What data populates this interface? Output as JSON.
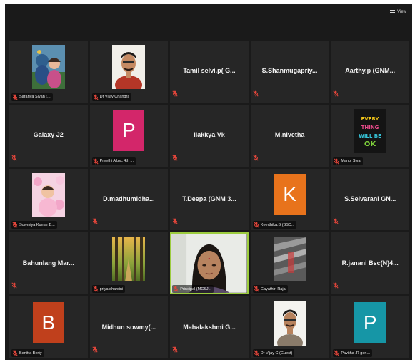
{
  "toolbar": {
    "view_label": "View"
  },
  "colors": {
    "meeting_bg": "#1a1a1a",
    "tile_bg": "#262626",
    "active_speaker_border": "#9ccc3e",
    "mic_muted": "#e0453a"
  },
  "participants": [
    {
      "display": "photo",
      "image": "child-portrait",
      "label": "Saranya Sivan (..."
    },
    {
      "display": "photo",
      "image": "man-portrait",
      "label": "Dr Vijay Chandra"
    },
    {
      "display": "name",
      "name": "Tamil selvi.p( G..."
    },
    {
      "display": "name",
      "name": "S.Shanmugapriy..."
    },
    {
      "display": "name",
      "name": "Aarthy.p  (GNM..."
    },
    {
      "display": "name",
      "name": "Galaxy J2"
    },
    {
      "display": "avatar",
      "initial": "P",
      "color": "#d3266a",
      "label": "Preethi A bsc 4th ..."
    },
    {
      "display": "name",
      "name": "Ilakkya Vk"
    },
    {
      "display": "name",
      "name": "M.nivetha"
    },
    {
      "display": "photo",
      "image": "quote-card",
      "label": "Manoj Siva",
      "quote": [
        "EVERY",
        "THING",
        "WILL BE",
        "OK"
      ]
    },
    {
      "display": "photo",
      "image": "baby-portrait",
      "label": "Sowmiya Kumar B..."
    },
    {
      "display": "name",
      "name": "D.madhumidha..."
    },
    {
      "display": "name",
      "name": "T.Deepa  (GNM 3..."
    },
    {
      "display": "avatar",
      "initial": "K",
      "color": "#e8731c",
      "label": "Keerthika.B (BSC..."
    },
    {
      "display": "name",
      "name": "S.Selvarani  GN..."
    },
    {
      "display": "name",
      "name": "Bahunlang  Mar..."
    },
    {
      "display": "photo",
      "image": "forest",
      "label": "priya dharsini"
    },
    {
      "display": "video",
      "image": "woman-video",
      "label": "Principal (MCSJ...",
      "active": true
    },
    {
      "display": "photo",
      "image": "abstract",
      "label": "Gayathiri Raja"
    },
    {
      "display": "name",
      "name": "R.janani Bsc(N)4..."
    },
    {
      "display": "avatar",
      "initial": "B",
      "color": "#c0401c",
      "label": "Benitta Berty"
    },
    {
      "display": "name",
      "name": "Midhun sowmy(..."
    },
    {
      "display": "name",
      "name": "Mahalakshmi  G..."
    },
    {
      "display": "photo",
      "image": "man-portrait-2",
      "label": "Dr Vijay C (Guest)"
    },
    {
      "display": "avatar",
      "initial": "P",
      "color": "#1696a6",
      "label": "Pavitha .R gen..."
    }
  ]
}
